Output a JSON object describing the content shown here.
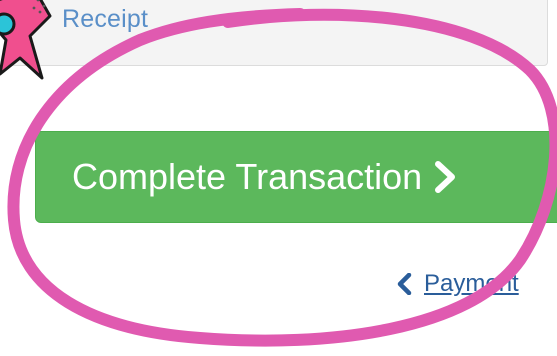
{
  "receipt": {
    "link_label": "Receipt"
  },
  "checkout": {
    "complete_label": "Complete Transaction",
    "back_label": "Payment"
  },
  "icons": {
    "complete": "chevron-right-icon",
    "back": "chevron-left-icon",
    "sticker": "star-icon"
  },
  "colors": {
    "complete_button": "#5cb85c",
    "link": "#2a5d9a",
    "annotation": "#e05ab0"
  }
}
